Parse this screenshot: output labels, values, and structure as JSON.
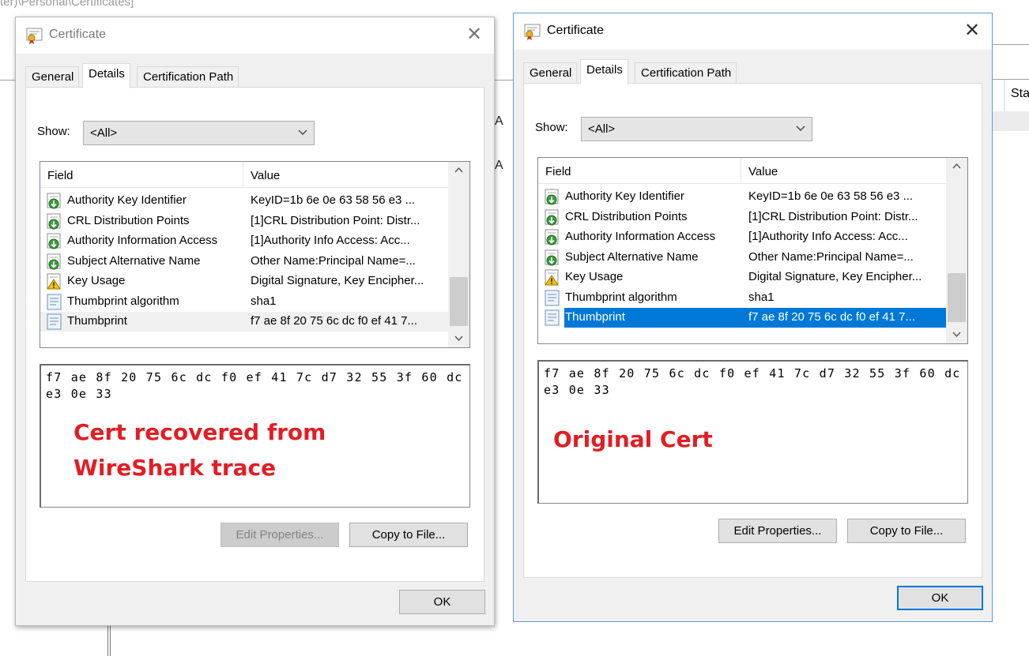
{
  "background": {
    "path_text": "ter)\\Personal\\Certificates]",
    "column_header": "Sta",
    "row_letters": [
      "A",
      "A"
    ]
  },
  "icons": {
    "title": "certificate-icon",
    "field_ext": "extension-green-arrow-icon",
    "field_critical": "extension-warning-icon",
    "field_prop": "property-document-icon",
    "close": "close-icon",
    "dropdown": "chevron-down-icon"
  },
  "colors": {
    "selection_blue": "#0078d7",
    "annotation_red": "#e31d24",
    "active_border": "#5a9bd5"
  },
  "left_dialog": {
    "title": "Certificate",
    "close_glyph": "✕",
    "tabs": [
      {
        "label": "General"
      },
      {
        "label": "Details"
      },
      {
        "label": "Certification Path"
      }
    ],
    "show_label": "Show:",
    "show_value": "<All>",
    "columns": {
      "field": "Field",
      "value": "Value"
    },
    "rows": [
      {
        "field": "Authority Key Identifier",
        "value": "KeyID=1b 6e 0e 63 58 56 e3 ...",
        "icon": "ext"
      },
      {
        "field": "CRL Distribution Points",
        "value": "[1]CRL Distribution Point: Distr...",
        "icon": "ext"
      },
      {
        "field": "Authority Information Access",
        "value": "[1]Authority Info Access: Acc...",
        "icon": "ext"
      },
      {
        "field": "Subject Alternative Name",
        "value": "Other Name:Principal Name=...",
        "icon": "ext"
      },
      {
        "field": "Key Usage",
        "value": "Digital Signature, Key Encipher...",
        "icon": "crit"
      },
      {
        "field": "Thumbprint algorithm",
        "value": "sha1",
        "icon": "prop"
      },
      {
        "field": "Thumbprint",
        "value": "f7 ae 8f 20 75 6c dc f0 ef 41 7...",
        "icon": "prop",
        "selected": "gray"
      }
    ],
    "detail_value": "f7 ae 8f 20 75 6c dc f0 ef 41 7c d7 32 55 3f 60 dc e3 0e 33",
    "annotation_line1": "Cert recovered from",
    "annotation_line2": "WireShark trace",
    "edit_button": "Edit Properties...",
    "copy_button": "Copy to File...",
    "ok_button": "OK"
  },
  "right_dialog": {
    "title": "Certificate",
    "close_glyph": "✕",
    "tabs": [
      {
        "label": "General"
      },
      {
        "label": "Details"
      },
      {
        "label": "Certification Path"
      }
    ],
    "show_label": "Show:",
    "show_value": "<All>",
    "columns": {
      "field": "Field",
      "value": "Value"
    },
    "rows": [
      {
        "field": "Authority Key Identifier",
        "value": "KeyID=1b 6e 0e 63 58 56 e3 ...",
        "icon": "ext"
      },
      {
        "field": "CRL Distribution Points",
        "value": "[1]CRL Distribution Point: Distr...",
        "icon": "ext"
      },
      {
        "field": "Authority Information Access",
        "value": "[1]Authority Info Access: Acc...",
        "icon": "ext"
      },
      {
        "field": "Subject Alternative Name",
        "value": "Other Name:Principal Name=...",
        "icon": "ext"
      },
      {
        "field": "Key Usage",
        "value": "Digital Signature, Key Encipher...",
        "icon": "crit"
      },
      {
        "field": "Thumbprint algorithm",
        "value": "sha1",
        "icon": "prop"
      },
      {
        "field": "Thumbprint",
        "value": "f7 ae 8f 20 75 6c dc f0 ef 41 7...",
        "icon": "prop",
        "selected": "blue"
      }
    ],
    "detail_value": "f7 ae 8f 20 75 6c dc f0 ef 41 7c d7 32 55 3f 60 dc e3 0e 33",
    "annotation_line1": "Original Cert",
    "edit_button": "Edit Properties...",
    "copy_button": "Copy to File...",
    "ok_button": "OK"
  }
}
